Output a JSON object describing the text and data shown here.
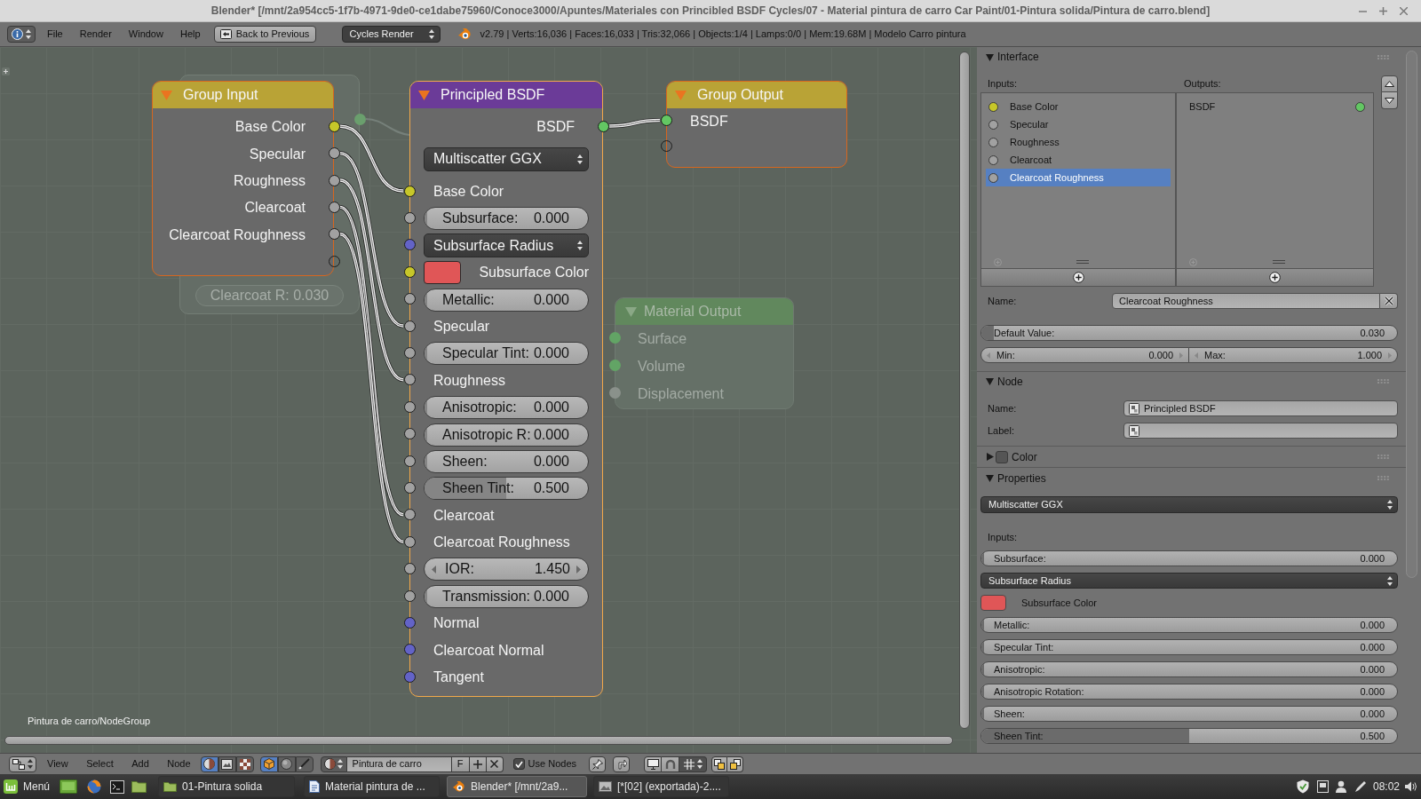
{
  "window": {
    "title": "Blender* [/mnt/2a954cc5-1f7b-4971-9de0-ce1dabe75960/Conoce3000/Apuntes/Materiales con Princibled BSDF Cycles/07 - Material pintura de carro Car Paint/01-Pintura solida/Pintura de carro.blend]"
  },
  "info_header": {
    "menus": [
      "File",
      "Render",
      "Window",
      "Help"
    ],
    "back_button": "Back to Previous",
    "render_engine": "Cycles Render",
    "stats": "v2.79 | Verts:16,036 | Faces:16,033 | Tris:32,066 | Objects:1/4 | Lamps:0/0 | Mem:19.68M | Modelo Carro pintura"
  },
  "node_editor": {
    "faded_group_node": {
      "field": "Clearcoat R: 0.030",
      "color": "#6a9f6d"
    },
    "faded_output_node": {
      "title": "Material Output",
      "color": "#61885d",
      "inputs": [
        {
          "label": "Surface",
          "color": "#62a465"
        },
        {
          "label": "Volume",
          "color": "#62a465"
        },
        {
          "label": "Displacement",
          "color": "#8a918b"
        }
      ]
    },
    "nodes": [
      {
        "kind": "group_input",
        "title": "Group Input",
        "color": "#b9a336",
        "selected": true,
        "active": false,
        "rows": [
          {
            "kind": "output",
            "label": "Base Color",
            "color": "#c7c729"
          },
          {
            "kind": "output",
            "label": "Specular",
            "color": "#a1a1a1"
          },
          {
            "kind": "output",
            "label": "Roughness",
            "color": "#a1a1a1"
          },
          {
            "kind": "output",
            "label": "Clearcoat",
            "color": "#a1a1a1"
          },
          {
            "kind": "output",
            "label": "Clearcoat Roughness",
            "color": "#a1a1a1"
          },
          {
            "kind": "empty_output"
          }
        ]
      },
      {
        "kind": "shader",
        "title": "Principled BSDF",
        "color": "#6b3b98",
        "selected": true,
        "active": true,
        "rows": [
          {
            "kind": "output",
            "label": "BSDF",
            "color": "#63c763"
          },
          {
            "kind": "dropdown",
            "label": "Multiscatter GGX"
          },
          {
            "kind": "input",
            "label": "Base Color",
            "color": "#c7c729"
          },
          {
            "kind": "slider",
            "label": "Subsurface:",
            "value": "0.000",
            "level": 0,
            "color": "#a1a1a1"
          },
          {
            "kind": "input_dropdown",
            "label": "Subsurface Radius",
            "color": "#6363c7"
          },
          {
            "kind": "input_color",
            "label": "Subsurface Color",
            "color": "#c7c729",
            "swatch": {
              "color": "#e05657"
            }
          },
          {
            "kind": "slider",
            "label": "Metallic:",
            "value": "0.000",
            "level": 0,
            "color": "#a1a1a1"
          },
          {
            "kind": "input",
            "label": "Specular",
            "color": "#a1a1a1"
          },
          {
            "kind": "slider",
            "label": "Specular Tint:",
            "value": "0.000",
            "level": 0,
            "color": "#a1a1a1"
          },
          {
            "kind": "input",
            "label": "Roughness",
            "color": "#a1a1a1"
          },
          {
            "kind": "slider",
            "label": "Anisotropic:",
            "value": "0.000",
            "level": 0,
            "color": "#a1a1a1"
          },
          {
            "kind": "slider",
            "label": "Anisotropic R:",
            "value": "0.000",
            "level": 0,
            "color": "#a1a1a1"
          },
          {
            "kind": "slider",
            "label": "Sheen:",
            "value": "0.000",
            "level": 0,
            "color": "#a1a1a1"
          },
          {
            "kind": "slider",
            "label": "Sheen Tint:",
            "value": "0.500",
            "level": 0.5,
            "color": "#a1a1a1"
          },
          {
            "kind": "input",
            "label": "Clearcoat",
            "color": "#a1a1a1"
          },
          {
            "kind": "input",
            "label": "Clearcoat Roughness",
            "color": "#a1a1a1"
          },
          {
            "kind": "number",
            "label": "IOR:",
            "value": "1.450",
            "color": "#a1a1a1"
          },
          {
            "kind": "slider",
            "label": "Transmission:",
            "value": "0.000",
            "level": 0,
            "color": "#a1a1a1"
          },
          {
            "kind": "input",
            "label": "Normal",
            "color": "#6363c7"
          },
          {
            "kind": "input",
            "label": "Clearcoat Normal",
            "color": "#6363c7"
          },
          {
            "kind": "input",
            "label": "Tangent",
            "color": "#6363c7"
          }
        ]
      },
      {
        "kind": "group_output",
        "title": "Group Output",
        "color": "#b9a336",
        "selected": true,
        "active": false,
        "rows": [
          {
            "kind": "input",
            "label": "BSDF",
            "color": "#63c763"
          },
          {
            "kind": "empty_input"
          }
        ]
      }
    ],
    "breadcrumb": "Pintura de carro/NodeGroup"
  },
  "sidebar": {
    "interface": {
      "title": "Interface",
      "expanded": true,
      "inputs_label": "Inputs:",
      "outputs_label": "Outputs:",
      "inputs": [
        {
          "label": "Base Color",
          "color": "#c7c729",
          "selected": false
        },
        {
          "label": "Specular",
          "color": "#a1a1a1",
          "selected": false
        },
        {
          "label": "Roughness",
          "color": "#a1a1a1",
          "selected": false
        },
        {
          "label": "Clearcoat",
          "color": "#a1a1a1",
          "selected": false
        },
        {
          "label": "Clearcoat Roughness",
          "color": "#a1a1a1",
          "selected": true
        }
      ],
      "outputs": [
        {
          "label": "BSDF",
          "color": "#63c763",
          "selected": false
        }
      ],
      "name_label": "Name:",
      "name": "Clearcoat Roughness",
      "default_value": {
        "label": "Default Value:",
        "value": "0.030",
        "level": 0.03
      },
      "min": {
        "label": "Min:",
        "value": "0.000"
      },
      "max": {
        "label": "Max:",
        "value": "1.000"
      }
    },
    "node": {
      "title": "Node",
      "expanded": true,
      "name_label": "Name:",
      "name": "Principled BSDF",
      "label_label": "Label:"
    },
    "color": {
      "title": "Color",
      "expanded": false,
      "checked": false
    },
    "properties": {
      "title": "Properties",
      "expanded": true,
      "distribution": "Multiscatter GGX",
      "inputs_label": "Inputs:",
      "rows": [
        {
          "kind": "slider",
          "label": "Subsurface:",
          "value": "0.000",
          "level": 0
        },
        {
          "kind": "dropdown",
          "label": "Subsurface Radius"
        },
        {
          "kind": "color",
          "label": "Subsurface Color",
          "color": "#e05657"
        },
        {
          "kind": "slider",
          "label": "Metallic:",
          "value": "0.000",
          "level": 0
        },
        {
          "kind": "slider",
          "label": "Specular Tint:",
          "value": "0.000",
          "level": 0
        },
        {
          "kind": "slider",
          "label": "Anisotropic:",
          "value": "0.000",
          "level": 0
        },
        {
          "kind": "slider",
          "label": "Anisotropic Rotation:",
          "value": "0.000",
          "level": 0
        },
        {
          "kind": "slider",
          "label": "Sheen:",
          "value": "0.000",
          "level": 0
        },
        {
          "kind": "slider",
          "label": "Sheen Tint:",
          "value": "0.500",
          "level": 0.5
        }
      ]
    }
  },
  "node_header": {
    "menus": [
      "View",
      "Select",
      "Add",
      "Node"
    ],
    "tree_types": [
      {
        "kind": "shader",
        "selected": true
      },
      {
        "kind": "compositing",
        "selected": false
      },
      {
        "kind": "texture",
        "selected": false
      }
    ],
    "shader_types": [
      {
        "kind": "object",
        "selected": true
      },
      {
        "kind": "world",
        "selected": false
      },
      {
        "kind": "line_style",
        "selected": false
      }
    ],
    "material": "Pintura de carro",
    "fake_user": "F",
    "use_nodes": {
      "label": "Use Nodes",
      "checked": true
    }
  },
  "taskbar": {
    "menu": "Menú",
    "tasks": [
      {
        "kind": "folder",
        "label": "01-Pintura solida",
        "selected": false
      },
      {
        "kind": "document",
        "label": "Material pintura de ...",
        "selected": false
      },
      {
        "kind": "blender",
        "label": "Blender* [/mnt/2a9...",
        "selected": true
      },
      {
        "kind": "image",
        "label": "[*[02] (exportada)-2....",
        "selected": false
      }
    ],
    "clock": "08:02"
  }
}
